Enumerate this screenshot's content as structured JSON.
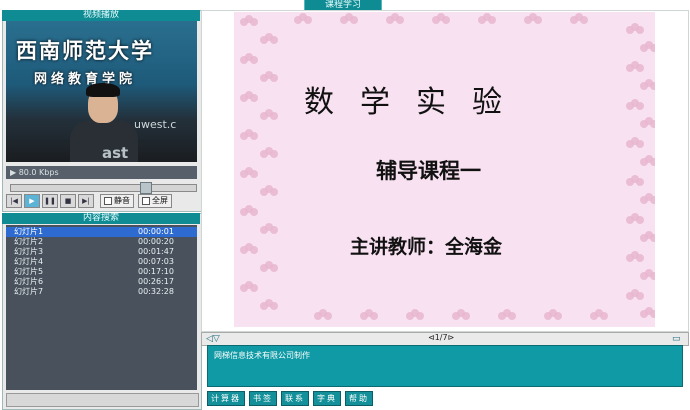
{
  "header": {
    "tab_title": "课程学习"
  },
  "video_panel": {
    "title": "视频播放",
    "banner_line1": "西南师范大学",
    "banner_line2": "网络教育学院",
    "watermark": "uwest.c",
    "watermark2": "ast",
    "bitrate": "80.0 Kbps",
    "controls": {
      "mute_label": "静音",
      "fullscreen_label": "全屏"
    }
  },
  "content_panel": {
    "title": "内容搜索",
    "items": [
      {
        "label": "幻灯片1",
        "time": "00:00:01",
        "selected": true
      },
      {
        "label": "幻灯片2",
        "time": "00:00:20"
      },
      {
        "label": "幻灯片3",
        "time": "00:01:47"
      },
      {
        "label": "幻灯片4",
        "time": "00:07:03"
      },
      {
        "label": "幻灯片5",
        "time": "00:17:10"
      },
      {
        "label": "幻灯片6",
        "time": "00:26:17"
      },
      {
        "label": "幻灯片7",
        "time": "00:32:28"
      }
    ]
  },
  "slide": {
    "title": "数学实验",
    "subtitle": "辅导课程一",
    "teacher": "主讲教师：全海金"
  },
  "navigation": {
    "page_indicator": "⊲1/7⊳"
  },
  "notes": {
    "text": "网梯信息技术有限公司制作"
  },
  "toolbar": [
    "计算器",
    "书签",
    "联系",
    "字典",
    "帮助"
  ],
  "colors": {
    "accent": "#0f8b93",
    "slide_bg": "#f8e1f1",
    "list_bg": "#49525c",
    "selection": "#2d6bd1"
  }
}
